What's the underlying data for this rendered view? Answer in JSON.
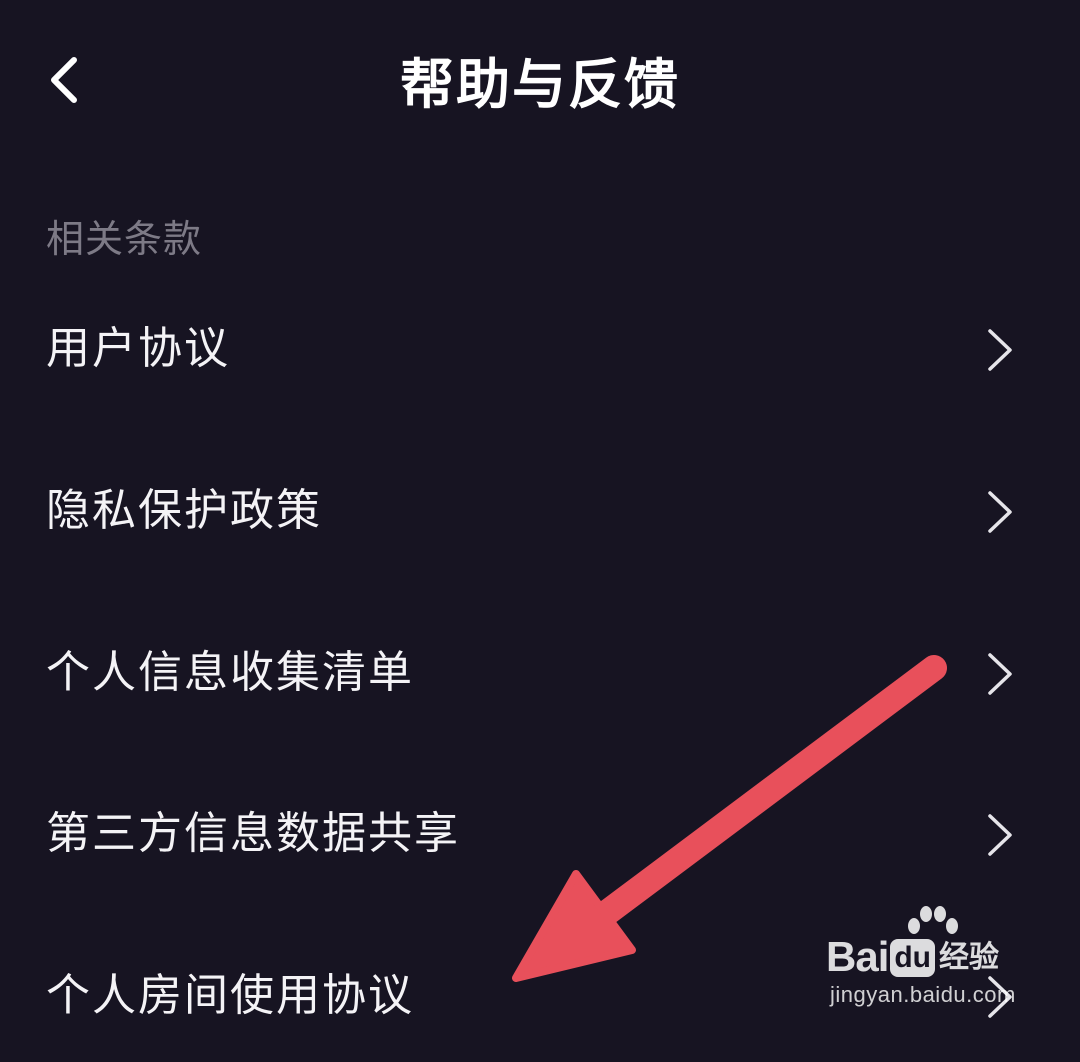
{
  "header": {
    "title": "帮助与反馈",
    "back_icon": "chevron-left-icon"
  },
  "section": {
    "label": "相关条款"
  },
  "menu": {
    "items": [
      {
        "label": "用户协议",
        "icon": "chevron-right-icon"
      },
      {
        "label": "隐私保护政策",
        "icon": "chevron-right-icon"
      },
      {
        "label": "个人信息收集清单",
        "icon": "chevron-right-icon"
      },
      {
        "label": "第三方信息数据共享",
        "icon": "chevron-right-icon"
      },
      {
        "label": "个人房间使用协议",
        "icon": "chevron-right-icon"
      }
    ]
  },
  "annotation": {
    "arrow_color": "#e8505b",
    "points_to": "个人房间使用协议"
  },
  "watermark": {
    "brand_text": "Bai",
    "brand_badge": "du",
    "brand_suffix": "经验",
    "url": "jingyan.baidu.com"
  },
  "colors": {
    "background": "#171422",
    "section_label": "#7d7a86",
    "text": "#f4f3f6"
  }
}
